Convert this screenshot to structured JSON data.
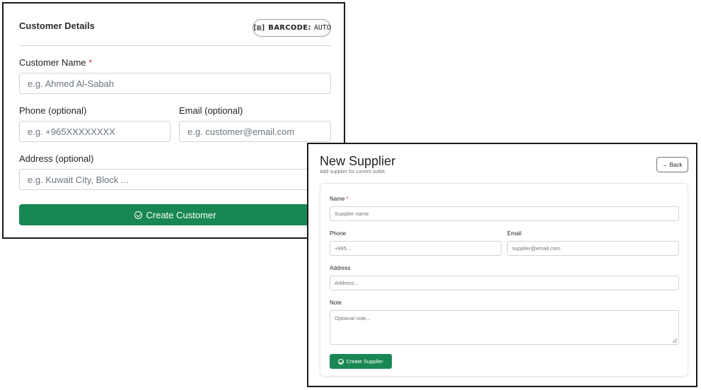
{
  "customer_panel": {
    "title": "Customer Details",
    "barcode": {
      "icon": "barcode-icon",
      "icon_glyph": "[▥]",
      "key": "BARCODE:",
      "value": "AUTO"
    },
    "fields": {
      "name": {
        "label": "Customer Name",
        "required_mark": "*",
        "placeholder": "e.g. Ahmed Al-Sabah"
      },
      "phone": {
        "label": "Phone (optional)",
        "placeholder": "e.g. +965XXXXXXXX"
      },
      "email": {
        "label": "Email (optional)",
        "placeholder": "e.g. customer@email.com"
      },
      "address": {
        "label": "Address (optional)",
        "placeholder": "e.g. Kuwait City, Block ..."
      }
    },
    "submit": {
      "icon": "check-circle-icon",
      "label": "Create Customer"
    }
  },
  "supplier_panel": {
    "title": "New Supplier",
    "subtitle": "Add supplier for current outlet.",
    "back": {
      "icon": "arrow-left-icon",
      "arrow": "←",
      "label": "Back"
    },
    "fields": {
      "name": {
        "label": "Name",
        "required_mark": "*",
        "placeholder": "Supplier name"
      },
      "phone": {
        "label": "Phone",
        "placeholder": "+965..."
      },
      "email": {
        "label": "Email",
        "placeholder": "supplier@email.com"
      },
      "address": {
        "label": "Address",
        "placeholder": "Address..."
      },
      "note": {
        "label": "Note",
        "placeholder": "Optional note..."
      }
    },
    "submit": {
      "icon": "check-circle-icon",
      "label": "Create Supplier"
    }
  },
  "colors": {
    "primary_green": "#198754",
    "required_red": "#dc3545",
    "placeholder_gray": "#6c757d",
    "input_border": "#ced4da"
  }
}
